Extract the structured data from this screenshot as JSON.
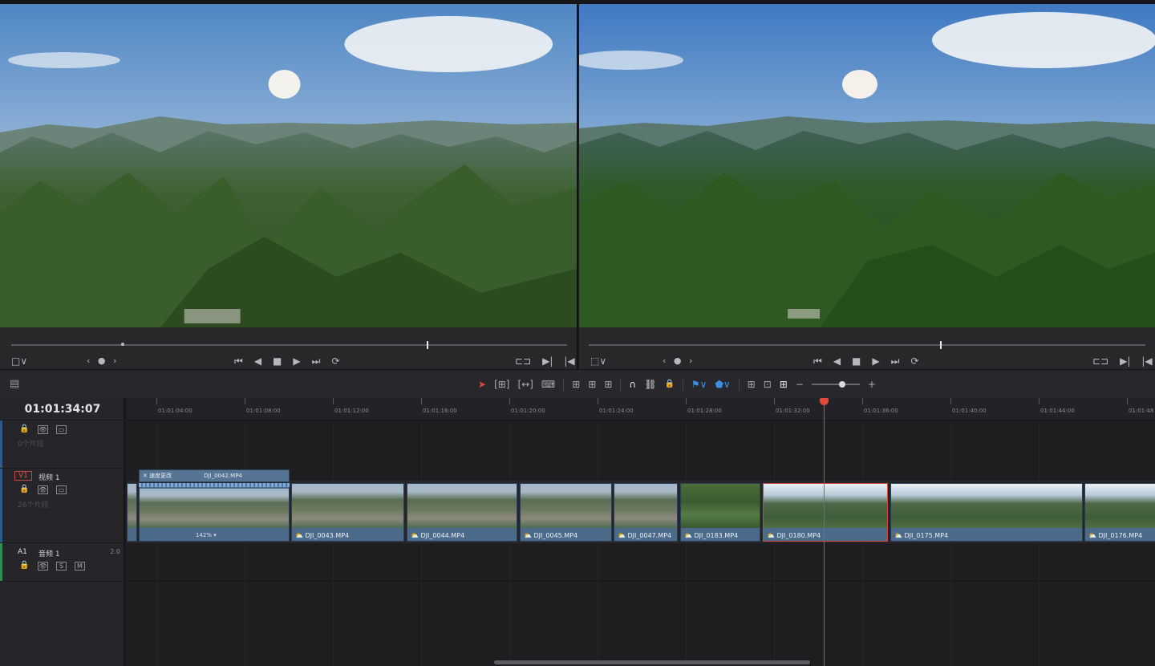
{
  "viewers": {
    "left": {
      "aspect_icon": "□∨",
      "pager": "‹ ● ›",
      "fit_icon": "⊏⊐"
    },
    "right": {
      "aspect_icon": "⬚∨",
      "pager": "‹ ● ›",
      "fit_icon": "⊏⊐"
    }
  },
  "transport": {
    "first": "⏮",
    "prev": "◀",
    "stop": "■",
    "play": "▶",
    "last": "⏭",
    "loop": "⟳",
    "next_frame": "▶|",
    "prev_frame": "|◀"
  },
  "toolbar": {
    "layout_icon": "▤",
    "select": "➤",
    "trim": "[⊞]",
    "blade_edit": "[↔]",
    "blade": "⌨",
    "insert": "⊞",
    "overwrite": "⊞",
    "replace": "⊞",
    "snap": "∩",
    "link": "⛓",
    "lock": "🔒",
    "flag": "⚑∨",
    "marker": "⬟∨",
    "zoom_full": "⊞",
    "zoom_detail": "⊡",
    "zoom_custom": "⊞",
    "zoom_minus": "−",
    "zoom_plus": "+"
  },
  "timeline": {
    "timecode": "01:01:34:07",
    "ruler": [
      "01:01:04:00",
      "01:01:08:00",
      "01:01:12:00",
      "01:01:16:00",
      "01:01:20:00",
      "01:01:24:00",
      "01:01:28:00",
      "01:01:32:00",
      "01:01:36:00",
      "01:01:40:00",
      "01:01:44:00",
      "01:01:48"
    ],
    "tracks": {
      "empty": {
        "clips": "0个片段"
      },
      "v1": {
        "id": "V1",
        "name": "视频 1",
        "clips": "26个片段"
      },
      "a1": {
        "id": "A1",
        "name": "音频 1",
        "level": "2.0"
      }
    },
    "speed_clip": {
      "tag": "速度更改",
      "name": "DJI_0042.MP4",
      "percent": "142% ▾"
    },
    "clips": [
      "DJI_0043.MP4",
      "DJI_0044.MP4",
      "DJI_0045.MP4",
      "DJI_0047.MP4",
      "DJI_0183.MP4",
      "DJI_0180.MP4",
      "DJI_0175.MP4",
      "DJI_0176.MP4"
    ],
    "icons": {
      "lock": "🔒",
      "eye": "👁",
      "monitor": "▭",
      "solo": "S",
      "mute": "M"
    }
  }
}
